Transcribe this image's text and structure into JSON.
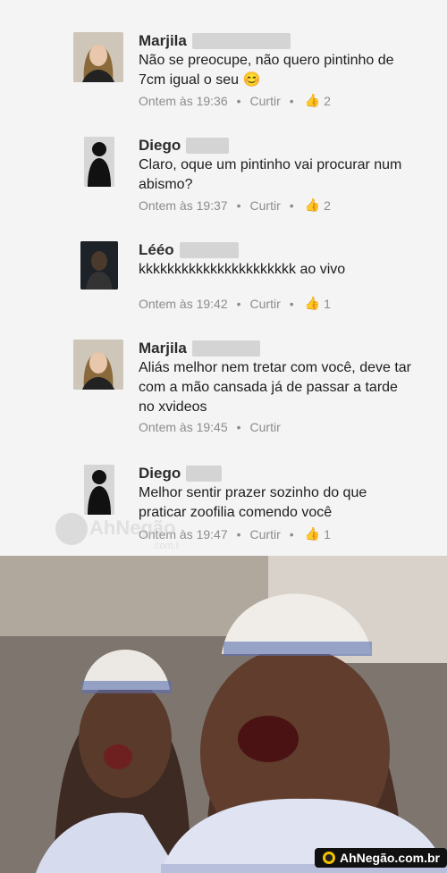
{
  "comments": [
    {
      "name": "Marjila",
      "text": "Não se preocupe, não quero pintinho de 7cm igual o seu",
      "time": "Ontem às 19:36",
      "reply": "Curtir",
      "likes": "2",
      "avatar": "female-avatar",
      "emoji": "😊"
    },
    {
      "name": "Diego",
      "text": "Claro, oque um pintinho vai procurar num abismo?",
      "time": "Ontem às 19:37",
      "reply": "Curtir",
      "likes": "2",
      "avatar": "male-avatar"
    },
    {
      "name": "Lééo",
      "text": "kkkkkkkkkkkkkkkkkkkkkk ao vivo",
      "time": "Ontem às 19:42",
      "reply": "Curtir",
      "likes": "1",
      "avatar": "dark-avatar"
    },
    {
      "name": "Marjila",
      "text": "Aliás melhor nem tretar com você, deve tar com a mão cansada já de passar a tarde no xvideos",
      "time": "Ontem às 19:45",
      "reply": "Curtir",
      "likes": "",
      "avatar": "female-avatar"
    },
    {
      "name": "Diego",
      "text": "Melhor sentir prazer sozinho do que praticar zoofilia comendo você",
      "time": "Ontem às 19:47",
      "reply": "Curtir",
      "likes": "1",
      "avatar": "male-avatar"
    }
  ],
  "watermark": {
    "text": "AhNegão",
    "sub": ".com.br"
  },
  "footer_logo": {
    "text": "AhNegão.com.br"
  },
  "colors": {
    "meta": "#8c8c8c",
    "name": "#2c2c2c",
    "text": "#1e1e1e"
  }
}
